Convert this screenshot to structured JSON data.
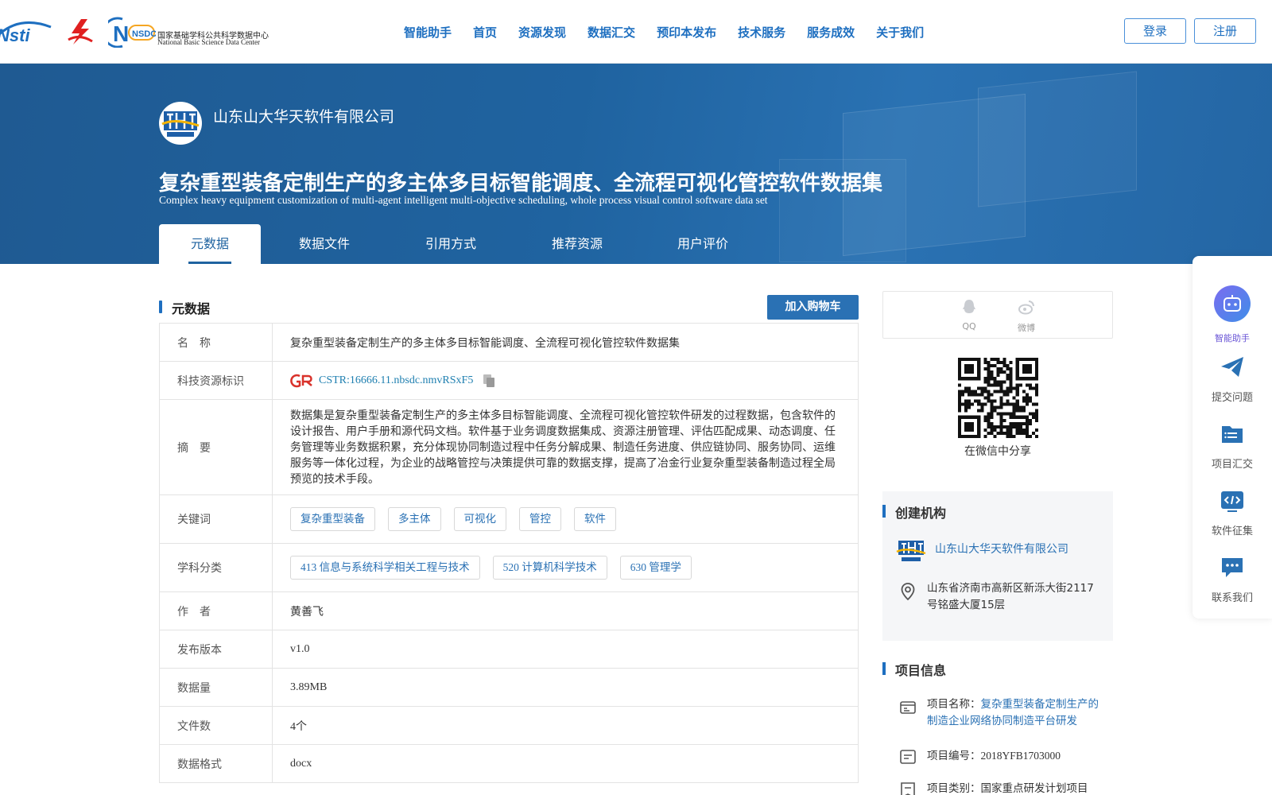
{
  "header": {
    "logos": {
      "nsti": "Nsti",
      "nsdc_badge": "NSDC",
      "nsdc_cn": "国家基础学科公共科学数据中心",
      "nsdc_en": "National Basic Science Data Center"
    },
    "nav": [
      "智能助手",
      "首页",
      "资源发现",
      "数据汇交",
      "预印本发布",
      "技术服务",
      "服务成效",
      "关于我们"
    ],
    "login": "登录",
    "register": "注册"
  },
  "banner": {
    "org_name": "山东山大华天软件有限公司",
    "title": "复杂重型装备定制生产的多主体多目标智能调度、全流程可视化管控软件数据集",
    "subtitle": "Complex heavy equipment customization of multi-agent intelligent multi-objective scheduling, whole process visual control software data set",
    "tabs": [
      "元数据",
      "数据文件",
      "引用方式",
      "推荐资源",
      "用户评价"
    ],
    "active_tab": "元数据"
  },
  "metadata": {
    "section_title": "元数据",
    "cart_button": "加入购物车",
    "labels": {
      "name": "名　称",
      "identifier": "科技资源标识",
      "abstract": "摘　要",
      "keywords": "关键词",
      "subjects": "学科分类",
      "author": "作　者",
      "version": "发布版本",
      "size": "数据量",
      "file_count": "文件数",
      "format": "数据格式"
    },
    "name": "复杂重型装备定制生产的多主体多目标智能调度、全流程可视化管控软件数据集",
    "identifier": "CSTR:16666.11.nbsdc.nmvRSxF5",
    "abstract": "数据集是复杂重型装备定制生产的多主体多目标智能调度、全流程可视化管控软件研发的过程数据，包含软件的设计报告、用户手册和源代码文档。软件基于业务调度数据集成、资源注册管理、评估匹配成果、动态调度、任务管理等业务数据积累，充分体现协同制造过程中任务分解成果、制造任务进度、供应链协同、服务协同、运维服务等一体化过程，为企业的战略管控与决策提供可靠的数据支撑，提高了冶金行业复杂重型装备制造过程全局预览的技术手段。",
    "keywords": [
      "复杂重型装备",
      "多主体",
      "可视化",
      "管控",
      "软件"
    ],
    "subjects": [
      "413 信息与系统科学相关工程与技术",
      "520 计算机科学技术",
      "630 管理学"
    ],
    "author": "黄善飞",
    "version": "v1.0",
    "size": "3.89MB",
    "file_count": "4个",
    "format": "docx"
  },
  "share": {
    "qq": "QQ",
    "weibo": "微博",
    "wechat_caption": "在微信中分享"
  },
  "creator": {
    "title": "创建机构",
    "org_name": "山东山大华天软件有限公司",
    "address": "山东省济南市高新区新泺大街2117号铭盛大厦15层"
  },
  "project": {
    "title": "项目信息",
    "name_label": "项目名称：",
    "name_value": "复杂重型装备定制生产的制造企业网络协同制造平台研发",
    "number_label": "项目编号：",
    "number_value": "2018YFB1703000",
    "category_label": "项目类别：",
    "category_value": "国家重点研发计划项目"
  },
  "float_bar": [
    "智能助手",
    "提交问题",
    "项目汇交",
    "软件征集",
    "联系我们"
  ],
  "colors": {
    "primary": "#1e6fc0",
    "banner": "#1f63a0",
    "button": "#2a71b4",
    "assistant": "#6a55d6"
  }
}
